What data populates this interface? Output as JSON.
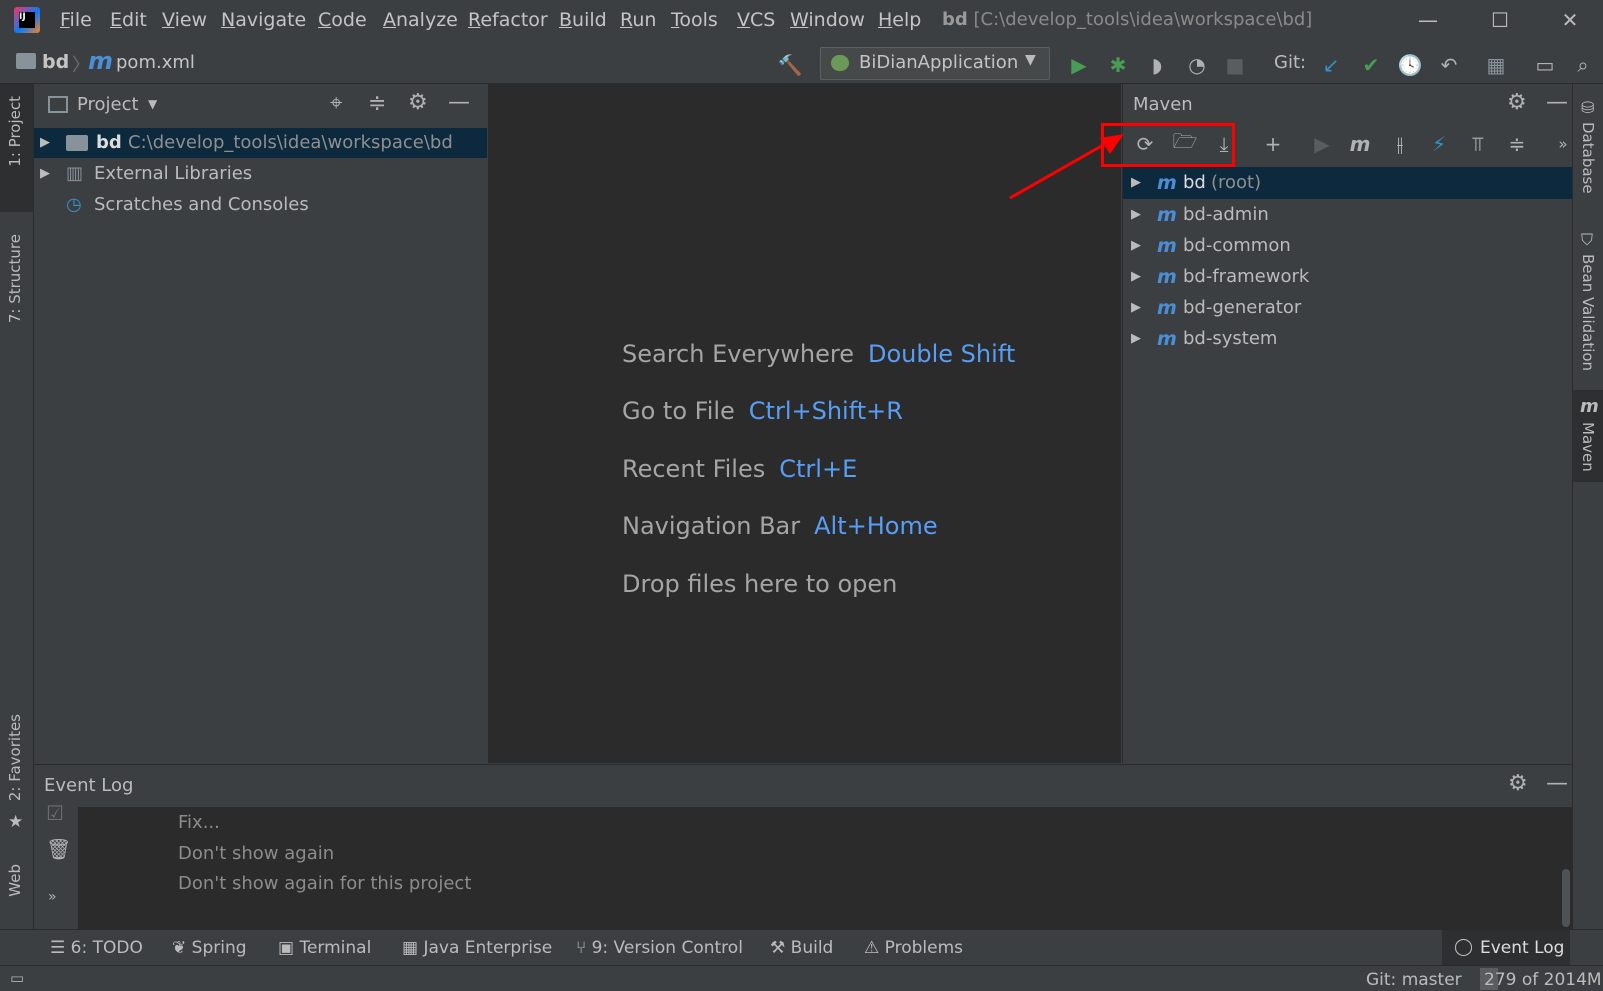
{
  "app": {
    "menu": [
      "File",
      "Edit",
      "View",
      "Navigate",
      "Code",
      "Analyze",
      "Refactor",
      "Build",
      "Run",
      "Tools",
      "VCS",
      "Window",
      "Help"
    ],
    "window_title_project": "bd",
    "window_title_path": "[C:\\develop_tools\\idea\\workspace\\bd]",
    "minimize": "—",
    "maximize": "☐",
    "close": "✕"
  },
  "navbar": {
    "project_crumb": "bd",
    "file_crumb": "pom.xml",
    "run_config": "BiDianApplication",
    "git_label": "Git:"
  },
  "left_stripe": {
    "project_tab": "1: Project",
    "structure_tab": "7: Structure",
    "favorites_tab": "2: Favorites",
    "web_tab": "Web"
  },
  "right_stripe": {
    "database_tab": "Database",
    "bean_validation_tab": "Bean Validation",
    "maven_tab": "Maven"
  },
  "project_panel": {
    "title": "Project",
    "tree": [
      {
        "name": "bd",
        "path": "C:\\develop_tools\\idea\\workspace\\bd"
      },
      {
        "name": "External Libraries"
      },
      {
        "name": "Scratches and Consoles"
      }
    ]
  },
  "editor_hints": [
    {
      "label": "Search Everywhere",
      "key": "Double Shift"
    },
    {
      "label": "Go to File",
      "key": "Ctrl+Shift+R"
    },
    {
      "label": "Recent Files",
      "key": "Ctrl+E"
    },
    {
      "label": "Navigation Bar",
      "key": "Alt+Home"
    },
    {
      "label": "Drop files here to open",
      "key": ""
    }
  ],
  "maven_panel": {
    "title": "Maven",
    "root": {
      "name": "bd",
      "suffix": "(root)"
    },
    "modules": [
      "bd-admin",
      "bd-common",
      "bd-framework",
      "bd-generator",
      "bd-system"
    ],
    "highlight_color": "#ff0000"
  },
  "event_log": {
    "title": "Event Log",
    "lines": [
      "Fix...",
      "Don't show again",
      "Don't show again for this project"
    ]
  },
  "bottom_tabs": {
    "todo": "6: TODO",
    "spring": "Spring",
    "terminal": "Terminal",
    "java_enterprise": "Java Enterprise",
    "version_control": "9: Version Control",
    "build": "Build",
    "problems": "Problems",
    "event_log": "Event Log"
  },
  "status": {
    "git_branch": "Git: master",
    "memory": "279 of 2014M"
  },
  "colors": {
    "accent": "#589df6",
    "run_green": "#499c54",
    "selection": "#0d293e"
  }
}
